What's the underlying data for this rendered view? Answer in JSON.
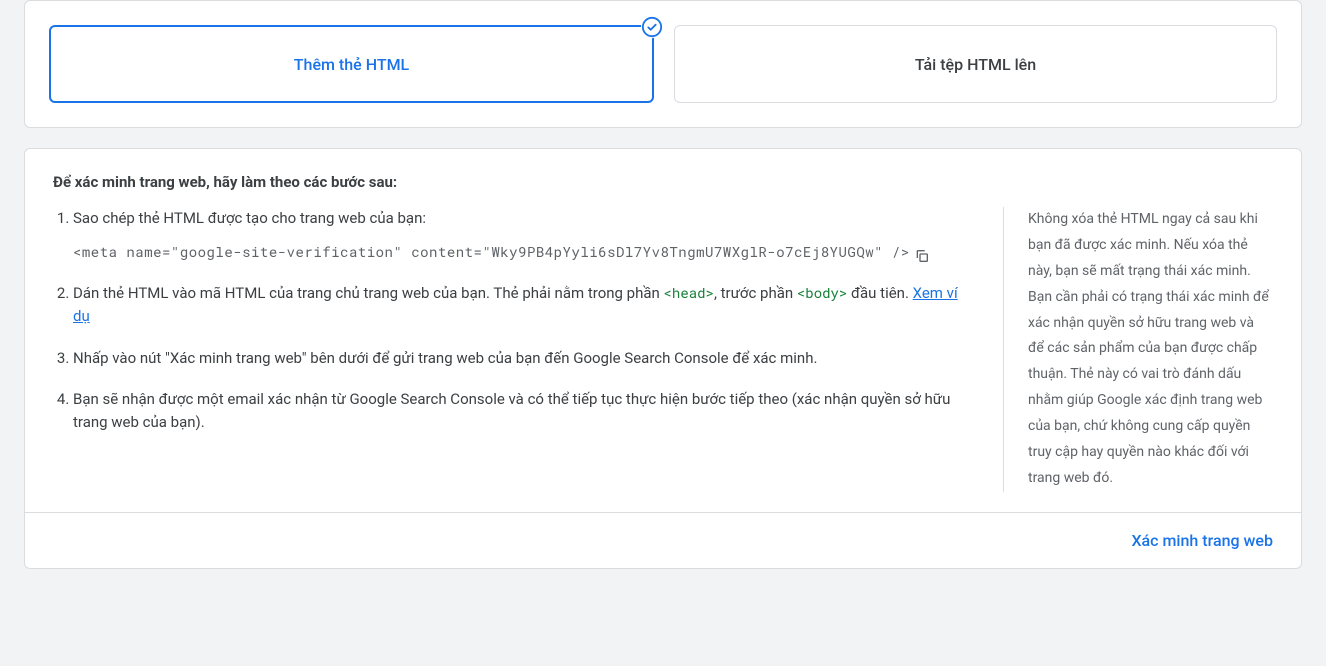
{
  "tabs": {
    "add_html": "Thêm thẻ HTML",
    "upload_html": "Tải tệp HTML lên"
  },
  "content": {
    "heading": "Để xác minh trang web, hãy làm theo các bước sau:",
    "steps": {
      "s1_text": "Sao chép thẻ HTML được tạo cho trang web của bạn:",
      "s1_code": "<meta name=\"google-site-verification\" content=\"Wky9PB4pYyli6sDl7Yv8TngmU7WXglR-o7cEj8YUGQw\" />",
      "s2_prefix": "Dán thẻ HTML vào mã HTML của trang chủ trang web của bạn. Thẻ phải nằm trong phần ",
      "s2_code_head": "<head>",
      "s2_mid": ", trước phần ",
      "s2_code_body": "<body>",
      "s2_suffix": " đầu tiên. ",
      "s2_link": "Xem ví dụ",
      "s3": "Nhấp vào nút \"Xác minh trang web\" bên dưới để gửi trang web của bạn đến Google Search Console để xác minh.",
      "s4": "Bạn sẽ nhận được một email xác nhận từ Google Search Console và có thể tiếp tục thực hiện bước tiếp theo (xác nhận quyền sở hữu trang web của bạn)."
    },
    "sidebar_note": "Không xóa thẻ HTML ngay cả sau khi bạn đã được xác minh. Nếu xóa thẻ này, bạn sẽ mất trạng thái xác minh. Bạn cần phải có trạng thái xác minh để xác nhận quyền sở hữu trang web và để các sản phẩm của bạn được chấp thuận. Thẻ này có vai trò đánh dấu nhằm giúp Google xác định trang web của bạn, chứ không cung cấp quyền truy cập hay quyền nào khác đối với trang web đó."
  },
  "footer": {
    "verify_button": "Xác minh trang web"
  }
}
